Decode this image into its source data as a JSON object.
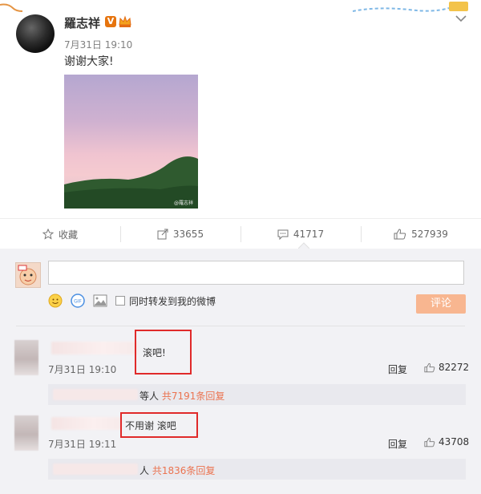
{
  "post": {
    "author": "羅志祥",
    "verified_badge": "V",
    "timestamp": "7月31日 19:10",
    "content": "谢谢大家!",
    "image": {
      "watermark": "@羅志祥"
    }
  },
  "actions": {
    "favorite_label": "收藏",
    "repost_count": "33655",
    "comment_count": "41717",
    "like_count": "527939"
  },
  "composer": {
    "input_value": "",
    "repost_label": "同时转发到我的微博",
    "submit_label": "评论"
  },
  "comments": [
    {
      "text": "滚吧!",
      "time": "7月31日 19:10",
      "reply_label": "回复",
      "likes": "82272",
      "sub_prefix": "等人",
      "sub_count": "共7191条回复"
    },
    {
      "text": "不用谢 滚吧",
      "time": "7月31日 19:11",
      "reply_label": "回复",
      "likes": "43708",
      "sub_prefix": "人",
      "sub_count": "共1836条回复"
    }
  ],
  "colors": {
    "accent": "#eb7350",
    "highlight": "#e02a2a",
    "submit": "#f8b690"
  }
}
